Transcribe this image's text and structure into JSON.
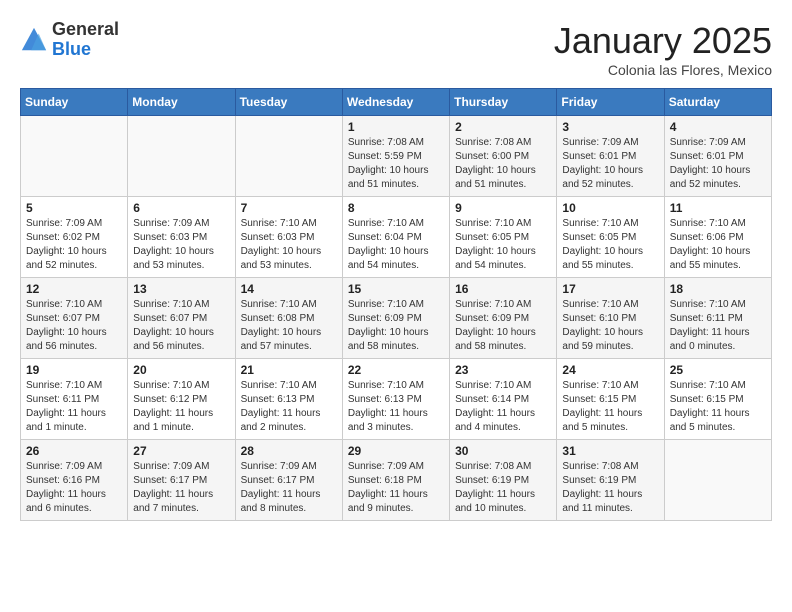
{
  "header": {
    "logo_general": "General",
    "logo_blue": "Blue",
    "month": "January 2025",
    "location": "Colonia las Flores, Mexico"
  },
  "weekdays": [
    "Sunday",
    "Monday",
    "Tuesday",
    "Wednesday",
    "Thursday",
    "Friday",
    "Saturday"
  ],
  "weeks": [
    [
      {
        "day": "",
        "sunrise": "",
        "sunset": "",
        "daylight": ""
      },
      {
        "day": "",
        "sunrise": "",
        "sunset": "",
        "daylight": ""
      },
      {
        "day": "",
        "sunrise": "",
        "sunset": "",
        "daylight": ""
      },
      {
        "day": "1",
        "sunrise": "Sunrise: 7:08 AM",
        "sunset": "Sunset: 5:59 PM",
        "daylight": "Daylight: 10 hours and 51 minutes."
      },
      {
        "day": "2",
        "sunrise": "Sunrise: 7:08 AM",
        "sunset": "Sunset: 6:00 PM",
        "daylight": "Daylight: 10 hours and 51 minutes."
      },
      {
        "day": "3",
        "sunrise": "Sunrise: 7:09 AM",
        "sunset": "Sunset: 6:01 PM",
        "daylight": "Daylight: 10 hours and 52 minutes."
      },
      {
        "day": "4",
        "sunrise": "Sunrise: 7:09 AM",
        "sunset": "Sunset: 6:01 PM",
        "daylight": "Daylight: 10 hours and 52 minutes."
      }
    ],
    [
      {
        "day": "5",
        "sunrise": "Sunrise: 7:09 AM",
        "sunset": "Sunset: 6:02 PM",
        "daylight": "Daylight: 10 hours and 52 minutes."
      },
      {
        "day": "6",
        "sunrise": "Sunrise: 7:09 AM",
        "sunset": "Sunset: 6:03 PM",
        "daylight": "Daylight: 10 hours and 53 minutes."
      },
      {
        "day": "7",
        "sunrise": "Sunrise: 7:10 AM",
        "sunset": "Sunset: 6:03 PM",
        "daylight": "Daylight: 10 hours and 53 minutes."
      },
      {
        "day": "8",
        "sunrise": "Sunrise: 7:10 AM",
        "sunset": "Sunset: 6:04 PM",
        "daylight": "Daylight: 10 hours and 54 minutes."
      },
      {
        "day": "9",
        "sunrise": "Sunrise: 7:10 AM",
        "sunset": "Sunset: 6:05 PM",
        "daylight": "Daylight: 10 hours and 54 minutes."
      },
      {
        "day": "10",
        "sunrise": "Sunrise: 7:10 AM",
        "sunset": "Sunset: 6:05 PM",
        "daylight": "Daylight: 10 hours and 55 minutes."
      },
      {
        "day": "11",
        "sunrise": "Sunrise: 7:10 AM",
        "sunset": "Sunset: 6:06 PM",
        "daylight": "Daylight: 10 hours and 55 minutes."
      }
    ],
    [
      {
        "day": "12",
        "sunrise": "Sunrise: 7:10 AM",
        "sunset": "Sunset: 6:07 PM",
        "daylight": "Daylight: 10 hours and 56 minutes."
      },
      {
        "day": "13",
        "sunrise": "Sunrise: 7:10 AM",
        "sunset": "Sunset: 6:07 PM",
        "daylight": "Daylight: 10 hours and 56 minutes."
      },
      {
        "day": "14",
        "sunrise": "Sunrise: 7:10 AM",
        "sunset": "Sunset: 6:08 PM",
        "daylight": "Daylight: 10 hours and 57 minutes."
      },
      {
        "day": "15",
        "sunrise": "Sunrise: 7:10 AM",
        "sunset": "Sunset: 6:09 PM",
        "daylight": "Daylight: 10 hours and 58 minutes."
      },
      {
        "day": "16",
        "sunrise": "Sunrise: 7:10 AM",
        "sunset": "Sunset: 6:09 PM",
        "daylight": "Daylight: 10 hours and 58 minutes."
      },
      {
        "day": "17",
        "sunrise": "Sunrise: 7:10 AM",
        "sunset": "Sunset: 6:10 PM",
        "daylight": "Daylight: 10 hours and 59 minutes."
      },
      {
        "day": "18",
        "sunrise": "Sunrise: 7:10 AM",
        "sunset": "Sunset: 6:11 PM",
        "daylight": "Daylight: 11 hours and 0 minutes."
      }
    ],
    [
      {
        "day": "19",
        "sunrise": "Sunrise: 7:10 AM",
        "sunset": "Sunset: 6:11 PM",
        "daylight": "Daylight: 11 hours and 1 minute."
      },
      {
        "day": "20",
        "sunrise": "Sunrise: 7:10 AM",
        "sunset": "Sunset: 6:12 PM",
        "daylight": "Daylight: 11 hours and 1 minute."
      },
      {
        "day": "21",
        "sunrise": "Sunrise: 7:10 AM",
        "sunset": "Sunset: 6:13 PM",
        "daylight": "Daylight: 11 hours and 2 minutes."
      },
      {
        "day": "22",
        "sunrise": "Sunrise: 7:10 AM",
        "sunset": "Sunset: 6:13 PM",
        "daylight": "Daylight: 11 hours and 3 minutes."
      },
      {
        "day": "23",
        "sunrise": "Sunrise: 7:10 AM",
        "sunset": "Sunset: 6:14 PM",
        "daylight": "Daylight: 11 hours and 4 minutes."
      },
      {
        "day": "24",
        "sunrise": "Sunrise: 7:10 AM",
        "sunset": "Sunset: 6:15 PM",
        "daylight": "Daylight: 11 hours and 5 minutes."
      },
      {
        "day": "25",
        "sunrise": "Sunrise: 7:10 AM",
        "sunset": "Sunset: 6:15 PM",
        "daylight": "Daylight: 11 hours and 5 minutes."
      }
    ],
    [
      {
        "day": "26",
        "sunrise": "Sunrise: 7:09 AM",
        "sunset": "Sunset: 6:16 PM",
        "daylight": "Daylight: 11 hours and 6 minutes."
      },
      {
        "day": "27",
        "sunrise": "Sunrise: 7:09 AM",
        "sunset": "Sunset: 6:17 PM",
        "daylight": "Daylight: 11 hours and 7 minutes."
      },
      {
        "day": "28",
        "sunrise": "Sunrise: 7:09 AM",
        "sunset": "Sunset: 6:17 PM",
        "daylight": "Daylight: 11 hours and 8 minutes."
      },
      {
        "day": "29",
        "sunrise": "Sunrise: 7:09 AM",
        "sunset": "Sunset: 6:18 PM",
        "daylight": "Daylight: 11 hours and 9 minutes."
      },
      {
        "day": "30",
        "sunrise": "Sunrise: 7:08 AM",
        "sunset": "Sunset: 6:19 PM",
        "daylight": "Daylight: 11 hours and 10 minutes."
      },
      {
        "day": "31",
        "sunrise": "Sunrise: 7:08 AM",
        "sunset": "Sunset: 6:19 PM",
        "daylight": "Daylight: 11 hours and 11 minutes."
      },
      {
        "day": "",
        "sunrise": "",
        "sunset": "",
        "daylight": ""
      }
    ]
  ]
}
